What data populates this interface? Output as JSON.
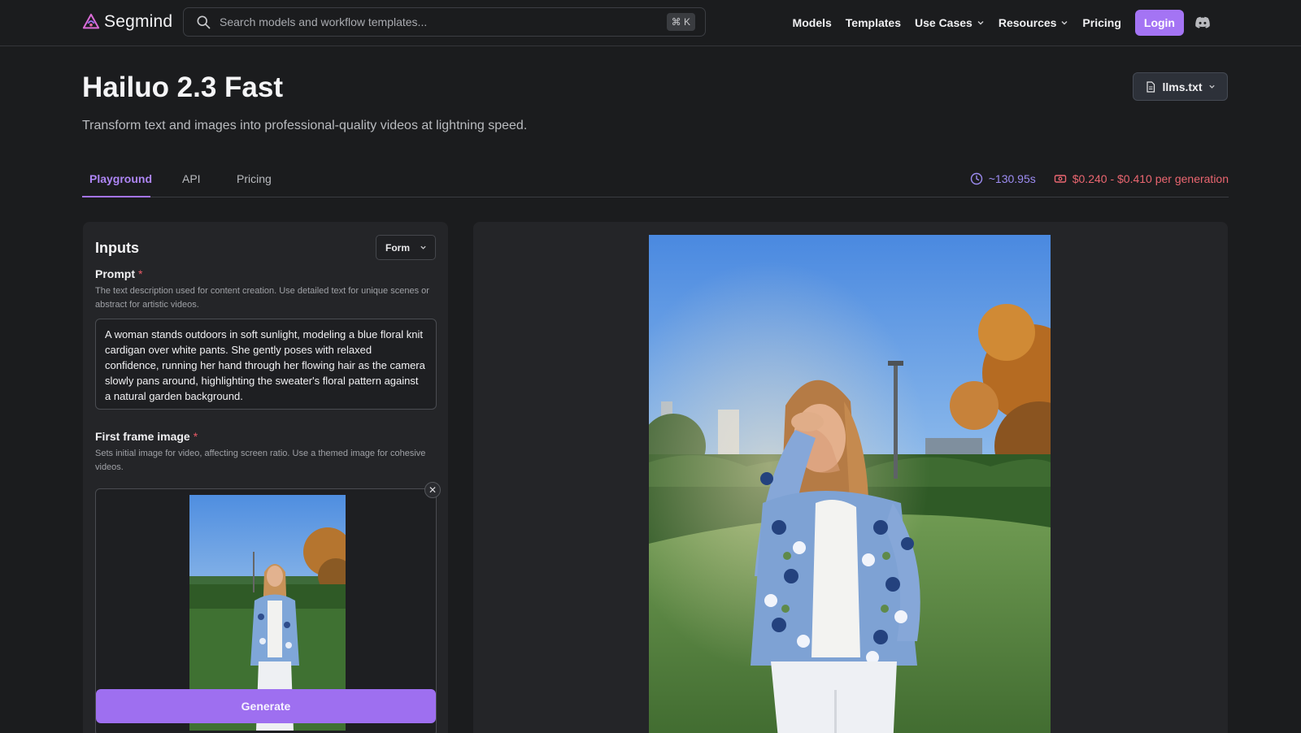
{
  "brand": {
    "name": "Segmind"
  },
  "search": {
    "placeholder": "Search models and workflow templates...",
    "shortcut": "⌘ K"
  },
  "nav": {
    "links": [
      "Models",
      "Templates",
      "Use Cases",
      "Resources",
      "Pricing"
    ],
    "login_label": "Login"
  },
  "header": {
    "title": "Hailuo 2.3 Fast",
    "subtitle": "Transform text and images into professional-quality videos at lightning speed.",
    "llms_button": "llms.txt"
  },
  "tabs": [
    {
      "label": "Playground",
      "active": true
    },
    {
      "label": "API",
      "active": false
    },
    {
      "label": "Pricing",
      "active": false
    }
  ],
  "meta": {
    "time": "~130.95s",
    "price": "$0.240 - $0.410 per generation"
  },
  "inputs": {
    "title": "Inputs",
    "mode": "Form",
    "prompt": {
      "label": "Prompt",
      "required_mark": "*",
      "help": "The text description used for content creation. Use detailed text for unique scenes or abstract for artistic videos.",
      "value": "A woman stands outdoors in soft sunlight, modeling a blue floral knit cardigan over white pants. She gently poses with relaxed confidence, running her hand through her flowing hair as the camera slowly pans around, highlighting the sweater's floral pattern against a natural garden background."
    },
    "first_frame": {
      "label": "First frame image",
      "required_mark": "*",
      "help": "Sets initial image for video, affecting screen ratio. Use a themed image for cohesive videos."
    },
    "generate_label": "Generate"
  },
  "colors": {
    "accent": "#a474f4",
    "background": "#1b1c1e",
    "panel": "#242528",
    "time_color": "#9d8cf2",
    "price_color": "#ea6670"
  },
  "icons": {
    "logo": "segmind-logo-icon",
    "search": "search-icon",
    "discord": "discord-icon",
    "file": "file-icon",
    "clock": "clock-icon",
    "price": "money-icon",
    "close": "close-icon"
  }
}
